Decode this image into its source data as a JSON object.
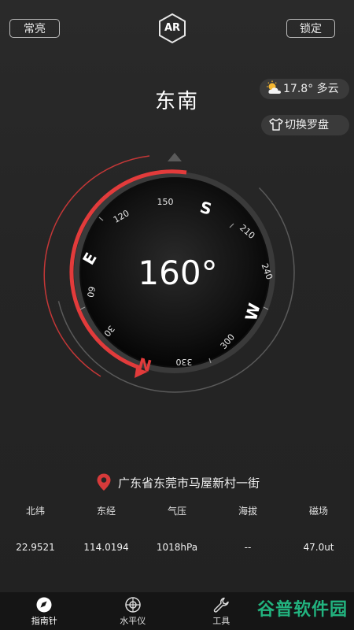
{
  "header": {
    "keep_on_label": "常亮",
    "ar_label": "AR",
    "lock_label": "锁定"
  },
  "direction_text": "东南",
  "weather": {
    "text": "17.8° 多云",
    "icon": "partly-cloudy-icon"
  },
  "skin_switch": {
    "text": "切换罗盘",
    "icon": "shirt-icon"
  },
  "compass": {
    "heading_text": "160°",
    "cardinals": [
      "S",
      "W",
      "N",
      "E"
    ],
    "ticks": [
      "150",
      "210",
      "240",
      "300",
      "330",
      "30",
      "60",
      "120"
    ],
    "accent_color": "#e23b3b"
  },
  "location": {
    "text": "广东省东莞市马屋新村一街",
    "icon": "map-pin-icon"
  },
  "stats": [
    {
      "label": "北纬",
      "value": "22.9521"
    },
    {
      "label": "东经",
      "value": "114.0194"
    },
    {
      "label": "气压",
      "value": "1018hPa"
    },
    {
      "label": "海拔",
      "value": "--"
    },
    {
      "label": "磁场",
      "value": "47.0ut"
    }
  ],
  "nav": [
    {
      "label": "指南针",
      "icon": "compass-icon",
      "active": true
    },
    {
      "label": "水平仪",
      "icon": "level-icon",
      "active": false
    },
    {
      "label": "工具",
      "icon": "wrench-icon",
      "active": false
    }
  ],
  "watermark": "谷普软件园"
}
